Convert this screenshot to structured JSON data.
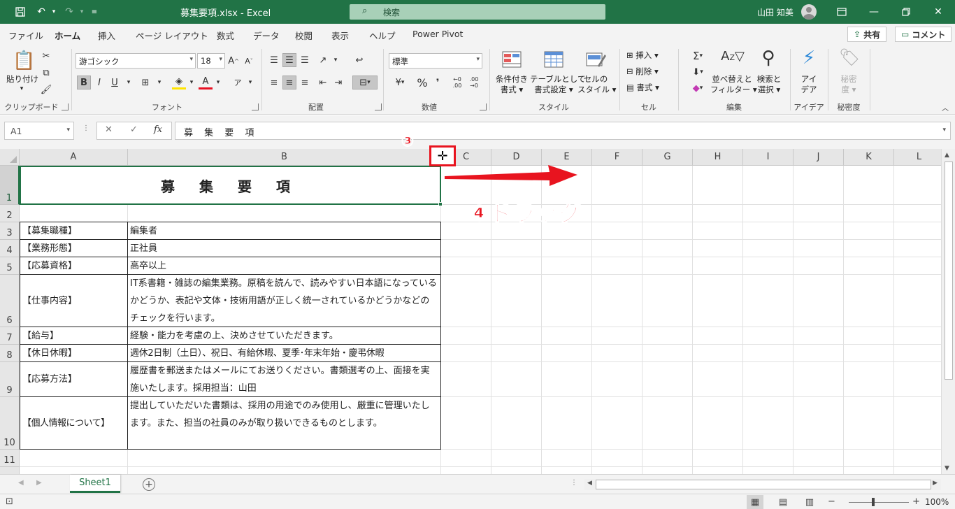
{
  "titlebar": {
    "doc_title": "募集要項.xlsx  -  Excel",
    "search_placeholder": "検索",
    "user_name": "山田 知美"
  },
  "menu": {
    "tabs": [
      "ファイル",
      "ホーム",
      "挿入",
      "ページ レイアウト",
      "数式",
      "データ",
      "校閲",
      "表示",
      "ヘルプ",
      "Power Pivot"
    ],
    "active_tab": "ホーム",
    "share_label": "共有",
    "comment_label": "コメント"
  },
  "ribbon": {
    "groups": [
      "クリップボード",
      "フォント",
      "配置",
      "数値",
      "スタイル",
      "セル",
      "編集",
      "アイデア",
      "秘密度"
    ],
    "paste_label": "貼り付け",
    "font_name": "游ゴシック",
    "font_size": "18",
    "number_format": "標準",
    "style_buttons": [
      {
        "line1": "条件付き",
        "line2": "書式"
      },
      {
        "line1": "テーブルとして",
        "line2": "書式設定"
      },
      {
        "line1": "セルの",
        "line2": "スタイル"
      }
    ],
    "cell_buttons": [
      "挿入",
      "削除",
      "書式"
    ],
    "sort_label": {
      "line1": "並べ替えと",
      "line2": "フィルター"
    },
    "find_label": {
      "line1": "検索と",
      "line2": "選択"
    },
    "ideas_label": {
      "line1": "アイ",
      "line2": "デア"
    },
    "sensitivity_label": {
      "line1": "秘密",
      "line2": "度"
    },
    "bold": "B",
    "italic": "I",
    "underline": "U",
    "percent": "%",
    "comma": "❜",
    "dec_inc": "←0 .00",
    "dec_dec": ".00 →0",
    "font_a": "A"
  },
  "formula_bar": {
    "name_box": "A1",
    "content": "募 集 要 項"
  },
  "columns": [
    "A",
    "B",
    "C",
    "D",
    "E",
    "F",
    "G",
    "H",
    "I",
    "J",
    "K",
    "L"
  ],
  "rows": [
    "1",
    "2",
    "3",
    "4",
    "5",
    "6",
    "7",
    "8",
    "9",
    "10",
    "11"
  ],
  "sheet": {
    "title": "募 集 要 項",
    "items": [
      {
        "label": "【募集職種】",
        "value": "編集者"
      },
      {
        "label": "【業務形態】",
        "value": "正社員"
      },
      {
        "label": "【応募資格】",
        "value": "高卒以上"
      },
      {
        "label": "【仕事内容】",
        "value": "IT系書籍・雑誌の編集業務。原稿を読んで、読みやすい日本語になっているかどうか、表記や文体・技術用語が正しく統一されているかどうかなどのチェックを行います。"
      },
      {
        "label": "【給与】",
        "value": "経験・能力を考慮の上、決めさせていただきます。"
      },
      {
        "label": "【休日休暇】",
        "value": "週休2日制（土日）、祝日、有給休暇、夏季･年末年始・慶弔休暇"
      },
      {
        "label": "【応募方法】",
        "value": "履歴書を郵送またはメールにてお送りください。書類選考の上、面接を実施いたします。採用担当：山田"
      },
      {
        "label": "【個人情報について】",
        "value": "提出していただいた書類は、採用の用途でのみ使用し、厳重に管理いたします。また、担当の社員のみが取り扱いできるものとします。"
      }
    ]
  },
  "annotations": {
    "step3": "③",
    "step4": "④ドラッグ",
    "cursor": "✛"
  },
  "sheet_tabs": {
    "active": "Sheet1"
  },
  "status": {
    "zoom": "100%"
  },
  "colors": {
    "excel_green": "#217346",
    "annotation_red": "#e8141f"
  }
}
